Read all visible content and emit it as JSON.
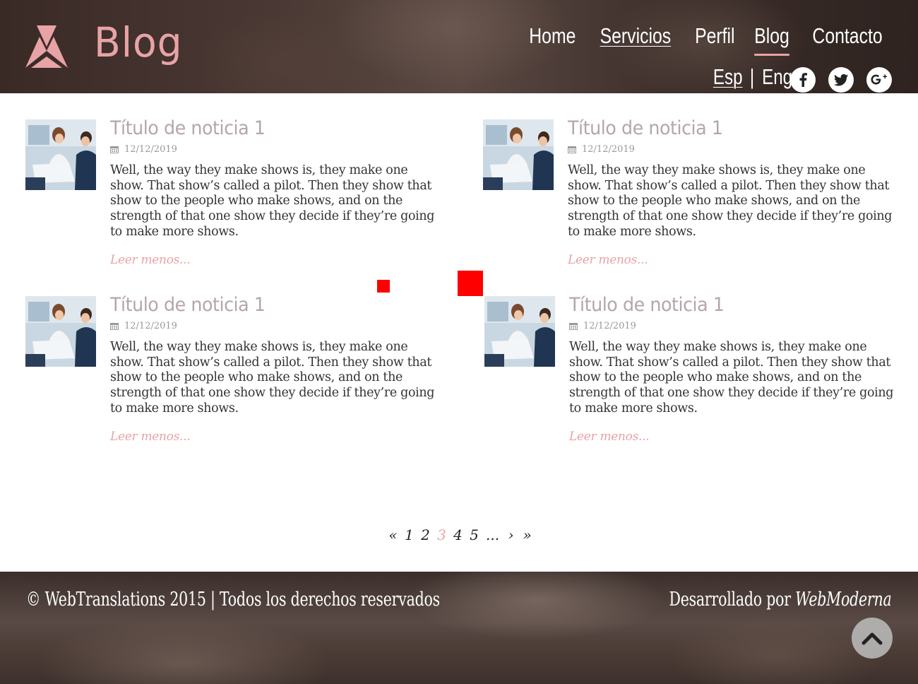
{
  "header": {
    "site_title": "Blog",
    "nav": [
      {
        "label": "Home",
        "state": "normal"
      },
      {
        "label": "Servicios",
        "state": "underlined"
      },
      {
        "label": "Perfil",
        "state": "normal"
      },
      {
        "label": "Blog",
        "state": "active"
      },
      {
        "label": "Contacto",
        "state": "normal"
      }
    ],
    "lang": {
      "esp": "Esp",
      "sep": "|",
      "eng": "Eng"
    },
    "social_icons": [
      "facebook-icon",
      "twitter-icon",
      "google-plus-icon"
    ]
  },
  "posts": [
    {
      "title": "Título de noticia 1",
      "date": "12/12/2019",
      "excerpt": "Well, the way they make shows is, they make one show. That show’s called a pilot. Then they show that show to the people who make shows, and on the strength of that one show they decide if they’re going to make more shows.",
      "more": "Leer menos..."
    },
    {
      "title": "Título de noticia 1",
      "date": "12/12/2019",
      "excerpt": "Well, the way they make shows is, they make one show. That show’s called a pilot. Then they show that show to the people who make shows, and on the strength of that one show they decide if they’re going to make more shows.",
      "more": "Leer menos..."
    },
    {
      "title": "Título de noticia 1",
      "date": "12/12/2019",
      "excerpt": "Well, the way they make shows is, they make one show. That show’s called a pilot. Then they show that show to the people who make shows, and on the strength of that one show they decide if they’re going to make more shows.",
      "more": "Leer menos..."
    },
    {
      "title": "Título de noticia 1",
      "date": "12/12/2019",
      "excerpt": "Well, the way they make shows is, they make one show. That show’s called a pilot. Then they show that show to the people who make shows, and on the strength of that one show they decide if they’re going to make more shows.",
      "more": "Leer menos..."
    }
  ],
  "pagination": {
    "first": "«",
    "pages": [
      "1",
      "2",
      "3",
      "4",
      "5"
    ],
    "current": "3",
    "ellipsis": "...",
    "next": "›",
    "last": "»"
  },
  "footer": {
    "copyright": "© WebTranslations 2015 | Todos los derechos reservados",
    "credit_prefix": "Desarrollado por",
    "credit_brand": "WebModerna"
  },
  "colors": {
    "accent": "#e8a3a6",
    "body_text": "#333333",
    "marker": "#ff0000"
  }
}
